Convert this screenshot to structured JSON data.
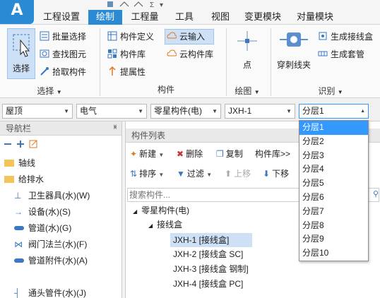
{
  "app": {
    "logo": "A"
  },
  "tabs": [
    "工程设置",
    "绘制",
    "工程量",
    "工具",
    "视图",
    "变更模块",
    "对量模块"
  ],
  "active_tab": 1,
  "ribbon": {
    "select_group": {
      "big_label": "选择",
      "items": [
        "批量选择",
        "查找图元",
        "拾取构件"
      ],
      "group_label": "选择"
    },
    "component_group": {
      "items": [
        "构件定义",
        "构件库",
        "提属性",
        "云输入",
        "云构件库"
      ],
      "group_label": "构件"
    },
    "draw_group": {
      "big_label": "点",
      "group_label": "绘图"
    },
    "identify_group": {
      "big_label": "穿刺线夹",
      "items": [
        "生成接线盒",
        "生成套管"
      ],
      "group_label": "识别"
    }
  },
  "combos": {
    "floor": "屋顶",
    "discipline": "电气",
    "type": "零星构件(电)",
    "component": "JXH-1",
    "layer": "分层1"
  },
  "nav": {
    "title": "导航栏",
    "items": [
      "轴线",
      "给排水",
      "卫生器具(水)(W)",
      "设备(水)(S)",
      "管道(水)(G)",
      "阀门法兰(水)(F)",
      "管道附件(水)(A)",
      "通头管件(水)(J)"
    ]
  },
  "component_list": {
    "title": "构件列表",
    "toolbar": {
      "new": "新建",
      "delete": "删除",
      "copy": "复制",
      "library": "构件库>>",
      "sort": "排序",
      "filter": "过滤",
      "move_up": "上移",
      "move_down": "下移"
    },
    "search_placeholder": "搜索构件...",
    "tree": {
      "root": "零星构件(电)",
      "group": "接线盒",
      "items": [
        "JXH-1 [接线盒]",
        "JXH-2 [接线盒 SC]",
        "JXH-3 [接线盒 钢制]",
        "JXH-4 [接线盒 PC]"
      ]
    }
  },
  "layer_dropdown": {
    "options": [
      "分层1",
      "分层2",
      "分层3",
      "分层4",
      "分层5",
      "分层6",
      "分层7",
      "分层8",
      "分层9",
      "分层10"
    ],
    "selected_index": 0
  },
  "colors": {
    "accent": "#2a8ad4",
    "selection": "#3399ff",
    "row_highlight": "#cde0f5"
  }
}
